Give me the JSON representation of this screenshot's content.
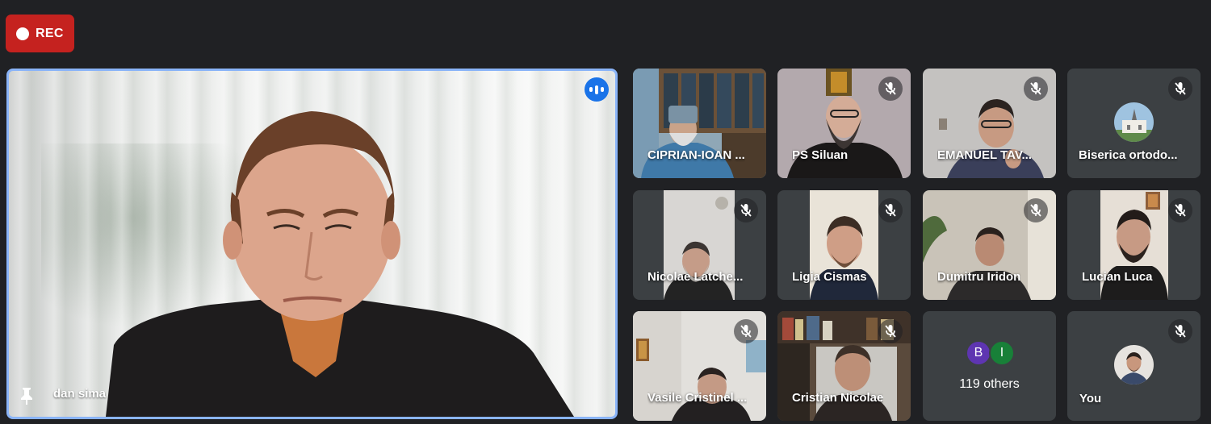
{
  "recording": {
    "label": "REC"
  },
  "main": {
    "name": "dan sima"
  },
  "tiles": [
    {
      "name": "CIPRIAN-IOAN ...",
      "muted": false
    },
    {
      "name": "PS Siluan",
      "muted": true
    },
    {
      "name": "EMANUEL TAV...",
      "muted": true
    },
    {
      "name": "Biserica ortodo...",
      "muted": true
    },
    {
      "name": "Nicolae Latche...",
      "muted": true
    },
    {
      "name": "Ligia Cismas",
      "muted": true
    },
    {
      "name": "Dumitru Iridon",
      "muted": true
    },
    {
      "name": "Lucian Luca",
      "muted": true
    },
    {
      "name": "Vasile Cristinel ...",
      "muted": true
    },
    {
      "name": "Cristian Nicolae",
      "muted": true
    }
  ],
  "others": {
    "count_label": "119 others",
    "badges": [
      {
        "letter": "B",
        "color": "#5e35b1"
      },
      {
        "letter": "I",
        "color": "#188038"
      }
    ]
  },
  "self": {
    "name": "You",
    "muted": true
  },
  "colors": {
    "background": "#202124",
    "tile": "#3c4043",
    "rec": "#c5221f",
    "active_border": "#8ab4f8",
    "speaking": "#1a73e8"
  }
}
